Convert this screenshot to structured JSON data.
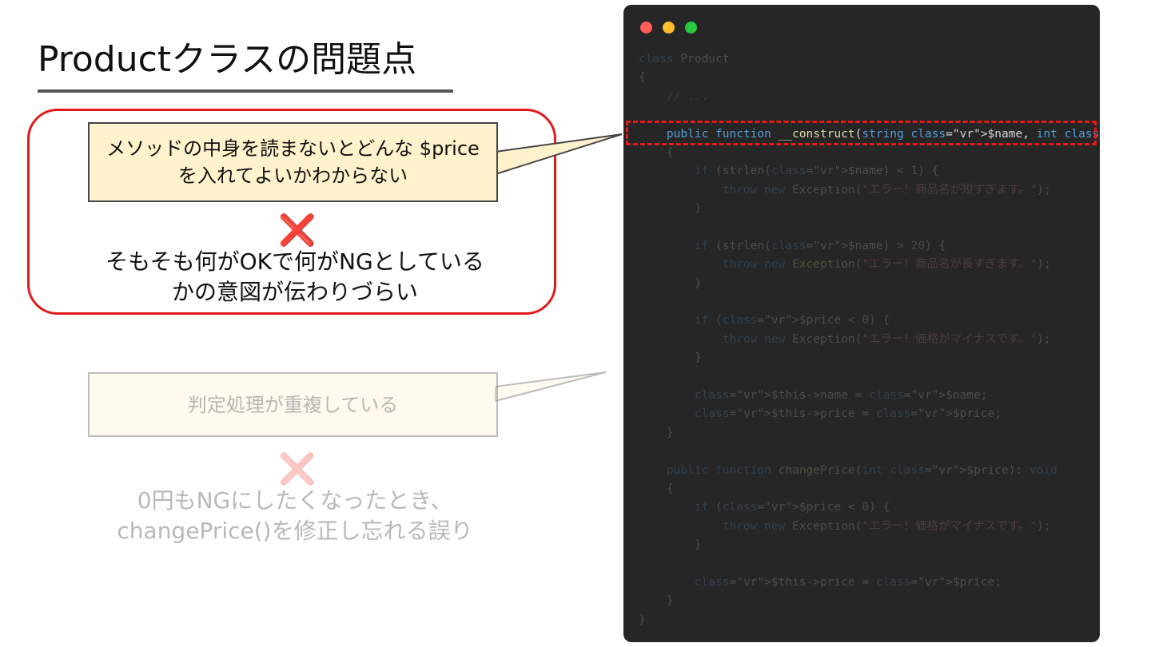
{
  "slide": {
    "title": "Productクラスの問題点",
    "callout_1": {
      "line1": "メソッドの中身を読まないとどんな $price",
      "line2": "を入れてよいかわからない"
    },
    "cross_mark": "❌",
    "statement_1": {
      "line1": "そもそも何がOKで何がNGとしている",
      "line2": "かの意図が伝わりづらい"
    },
    "callout_2": {
      "line1": "判定処理が重複している"
    },
    "statement_2": {
      "line1": "0円もNGにしたくなったとき、",
      "line2": "changePrice()を修正し忘れる誤り"
    },
    "colors": {
      "accent_red": "#e01b1b",
      "callout_fill": "#fff2cc",
      "code_bg": "#262626"
    }
  },
  "code": {
    "lines": [
      "class Product",
      "{",
      "    // ...",
      "",
      "    public function __construct(string $name, int $price)",
      "    {",
      "        if (strlen($name) < 1) {",
      "            throw new Exception(\"エラー！商品名が短すぎます。\");",
      "        }",
      "",
      "        if (strlen($name) > 20) {",
      "            throw new Exception(\"エラー！商品名が長すぎます。\");",
      "        }",
      "",
      "        if ($price < 0) {",
      "            throw new Exception(\"エラー！価格がマイナスです。\");",
      "        }",
      "",
      "        $this->name = $name;",
      "        $this->price = $price;",
      "    }",
      "",
      "    public function changePrice(int $price): void",
      "    {",
      "        if ($price < 0) {",
      "            throw new Exception(\"エラー！価格がマイナスです。\");",
      "        }",
      "",
      "        $this->price = $price;",
      "    }",
      "}"
    ],
    "highlighted_line": 4
  }
}
